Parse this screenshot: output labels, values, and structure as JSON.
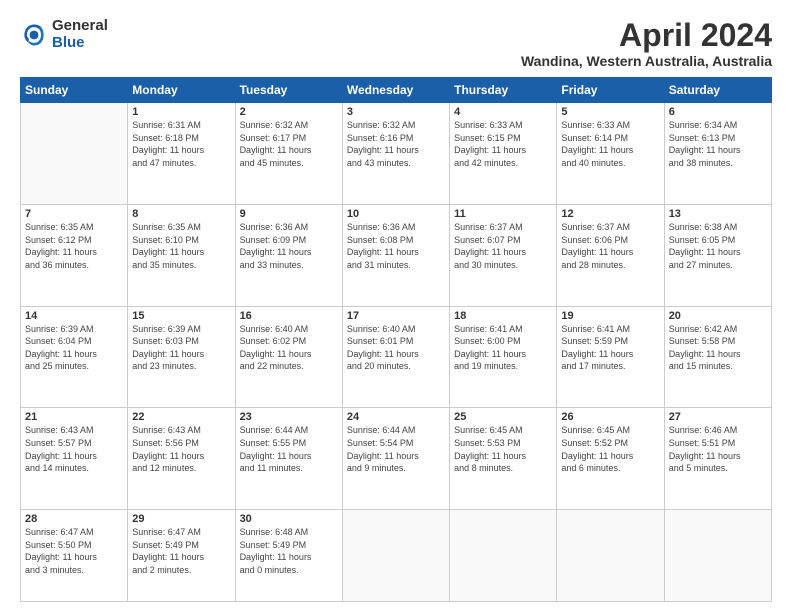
{
  "logo": {
    "general": "General",
    "blue": "Blue"
  },
  "title": "April 2024",
  "subtitle": "Wandina, Western Australia, Australia",
  "headers": [
    "Sunday",
    "Monday",
    "Tuesday",
    "Wednesday",
    "Thursday",
    "Friday",
    "Saturday"
  ],
  "weeks": [
    [
      {
        "num": "",
        "text": ""
      },
      {
        "num": "1",
        "text": "Sunrise: 6:31 AM\nSunset: 6:18 PM\nDaylight: 11 hours\nand 47 minutes."
      },
      {
        "num": "2",
        "text": "Sunrise: 6:32 AM\nSunset: 6:17 PM\nDaylight: 11 hours\nand 45 minutes."
      },
      {
        "num": "3",
        "text": "Sunrise: 6:32 AM\nSunset: 6:16 PM\nDaylight: 11 hours\nand 43 minutes."
      },
      {
        "num": "4",
        "text": "Sunrise: 6:33 AM\nSunset: 6:15 PM\nDaylight: 11 hours\nand 42 minutes."
      },
      {
        "num": "5",
        "text": "Sunrise: 6:33 AM\nSunset: 6:14 PM\nDaylight: 11 hours\nand 40 minutes."
      },
      {
        "num": "6",
        "text": "Sunrise: 6:34 AM\nSunset: 6:13 PM\nDaylight: 11 hours\nand 38 minutes."
      }
    ],
    [
      {
        "num": "7",
        "text": "Sunrise: 6:35 AM\nSunset: 6:12 PM\nDaylight: 11 hours\nand 36 minutes."
      },
      {
        "num": "8",
        "text": "Sunrise: 6:35 AM\nSunset: 6:10 PM\nDaylight: 11 hours\nand 35 minutes."
      },
      {
        "num": "9",
        "text": "Sunrise: 6:36 AM\nSunset: 6:09 PM\nDaylight: 11 hours\nand 33 minutes."
      },
      {
        "num": "10",
        "text": "Sunrise: 6:36 AM\nSunset: 6:08 PM\nDaylight: 11 hours\nand 31 minutes."
      },
      {
        "num": "11",
        "text": "Sunrise: 6:37 AM\nSunset: 6:07 PM\nDaylight: 11 hours\nand 30 minutes."
      },
      {
        "num": "12",
        "text": "Sunrise: 6:37 AM\nSunset: 6:06 PM\nDaylight: 11 hours\nand 28 minutes."
      },
      {
        "num": "13",
        "text": "Sunrise: 6:38 AM\nSunset: 6:05 PM\nDaylight: 11 hours\nand 27 minutes."
      }
    ],
    [
      {
        "num": "14",
        "text": "Sunrise: 6:39 AM\nSunset: 6:04 PM\nDaylight: 11 hours\nand 25 minutes."
      },
      {
        "num": "15",
        "text": "Sunrise: 6:39 AM\nSunset: 6:03 PM\nDaylight: 11 hours\nand 23 minutes."
      },
      {
        "num": "16",
        "text": "Sunrise: 6:40 AM\nSunset: 6:02 PM\nDaylight: 11 hours\nand 22 minutes."
      },
      {
        "num": "17",
        "text": "Sunrise: 6:40 AM\nSunset: 6:01 PM\nDaylight: 11 hours\nand 20 minutes."
      },
      {
        "num": "18",
        "text": "Sunrise: 6:41 AM\nSunset: 6:00 PM\nDaylight: 11 hours\nand 19 minutes."
      },
      {
        "num": "19",
        "text": "Sunrise: 6:41 AM\nSunset: 5:59 PM\nDaylight: 11 hours\nand 17 minutes."
      },
      {
        "num": "20",
        "text": "Sunrise: 6:42 AM\nSunset: 5:58 PM\nDaylight: 11 hours\nand 15 minutes."
      }
    ],
    [
      {
        "num": "21",
        "text": "Sunrise: 6:43 AM\nSunset: 5:57 PM\nDaylight: 11 hours\nand 14 minutes."
      },
      {
        "num": "22",
        "text": "Sunrise: 6:43 AM\nSunset: 5:56 PM\nDaylight: 11 hours\nand 12 minutes."
      },
      {
        "num": "23",
        "text": "Sunrise: 6:44 AM\nSunset: 5:55 PM\nDaylight: 11 hours\nand 11 minutes."
      },
      {
        "num": "24",
        "text": "Sunrise: 6:44 AM\nSunset: 5:54 PM\nDaylight: 11 hours\nand 9 minutes."
      },
      {
        "num": "25",
        "text": "Sunrise: 6:45 AM\nSunset: 5:53 PM\nDaylight: 11 hours\nand 8 minutes."
      },
      {
        "num": "26",
        "text": "Sunrise: 6:45 AM\nSunset: 5:52 PM\nDaylight: 11 hours\nand 6 minutes."
      },
      {
        "num": "27",
        "text": "Sunrise: 6:46 AM\nSunset: 5:51 PM\nDaylight: 11 hours\nand 5 minutes."
      }
    ],
    [
      {
        "num": "28",
        "text": "Sunrise: 6:47 AM\nSunset: 5:50 PM\nDaylight: 11 hours\nand 3 minutes."
      },
      {
        "num": "29",
        "text": "Sunrise: 6:47 AM\nSunset: 5:49 PM\nDaylight: 11 hours\nand 2 minutes."
      },
      {
        "num": "30",
        "text": "Sunrise: 6:48 AM\nSunset: 5:49 PM\nDaylight: 11 hours\nand 0 minutes."
      },
      {
        "num": "",
        "text": ""
      },
      {
        "num": "",
        "text": ""
      },
      {
        "num": "",
        "text": ""
      },
      {
        "num": "",
        "text": ""
      }
    ]
  ]
}
